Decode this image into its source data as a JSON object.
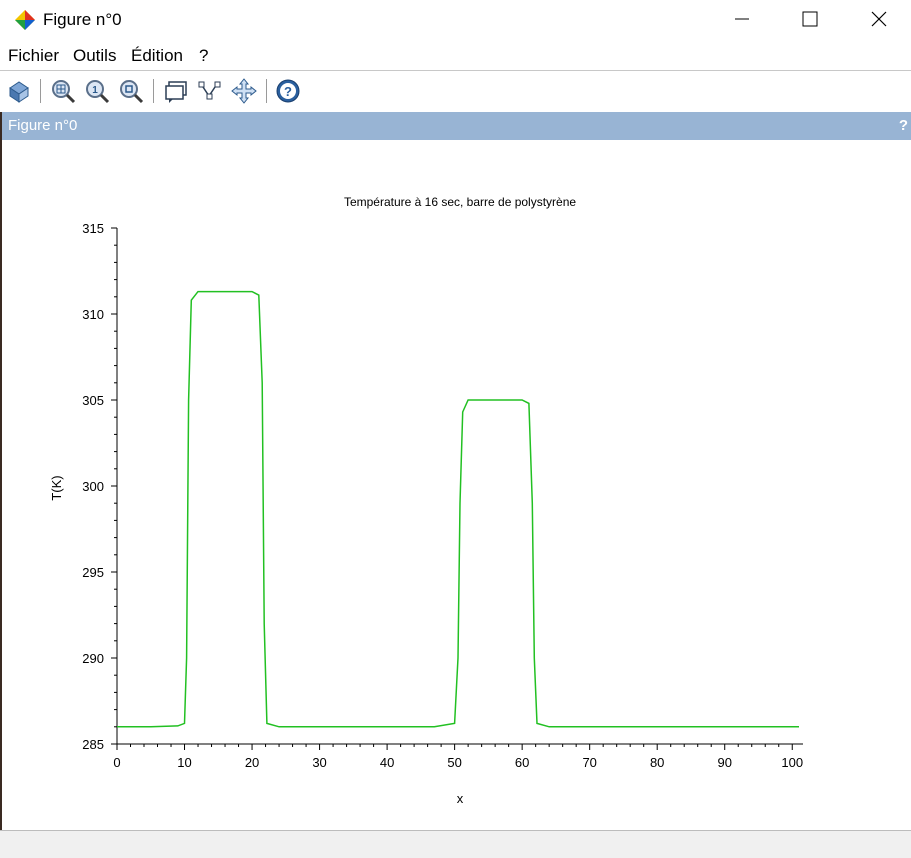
{
  "window": {
    "title": "Figure n°0",
    "minimize_label": "—",
    "maximize_label": "☐",
    "close_label": "✕"
  },
  "menu": {
    "items": [
      {
        "label": "Fichier"
      },
      {
        "label": "Outils"
      },
      {
        "label": "Édition"
      },
      {
        "label": "?"
      }
    ]
  },
  "toolbar": {
    "icons": [
      "rotate-2d-3d-icon",
      "zoom-area-icon",
      "zoom-reset-icon",
      "zoom-unzoom-icon",
      "datatip-icon",
      "edit-curve-icon",
      "pan-icon",
      "help-icon"
    ]
  },
  "figure_panel": {
    "title": "Figure n°0",
    "help_label": "?"
  },
  "colors": {
    "line": "#22c022",
    "panel_header": "#98b4d4"
  },
  "chart_data": {
    "type": "line",
    "title": "Température à 16 sec, barre de polystyrène",
    "xlabel": "x",
    "ylabel": "T(K)",
    "xlim": [
      0,
      101
    ],
    "ylim": [
      285,
      315
    ],
    "xticks": [
      0,
      10,
      20,
      30,
      40,
      50,
      60,
      70,
      80,
      90,
      100
    ],
    "yticks": [
      285,
      290,
      295,
      300,
      305,
      310,
      315
    ],
    "grid": false,
    "series": [
      {
        "color": "#22c022",
        "x": [
          0,
          5,
          9,
          10,
          10.3,
          10.6,
          11,
          12,
          15,
          20,
          21,
          21.5,
          21.8,
          22.2,
          24,
          30,
          40,
          47,
          50,
          50.5,
          50.8,
          51.2,
          52,
          55,
          60,
          61,
          61.5,
          61.8,
          62.2,
          64,
          70,
          80,
          90,
          101
        ],
        "y": [
          286.0,
          286.0,
          286.05,
          286.2,
          290,
          305,
          310.8,
          311.3,
          311.3,
          311.3,
          311.1,
          306,
          292,
          286.2,
          286.0,
          286.0,
          286.0,
          286.0,
          286.2,
          290,
          299,
          304.3,
          305.0,
          305.0,
          305.0,
          304.8,
          299,
          290,
          286.2,
          286.0,
          286.0,
          286.0,
          286.0,
          286.0
        ]
      }
    ]
  }
}
